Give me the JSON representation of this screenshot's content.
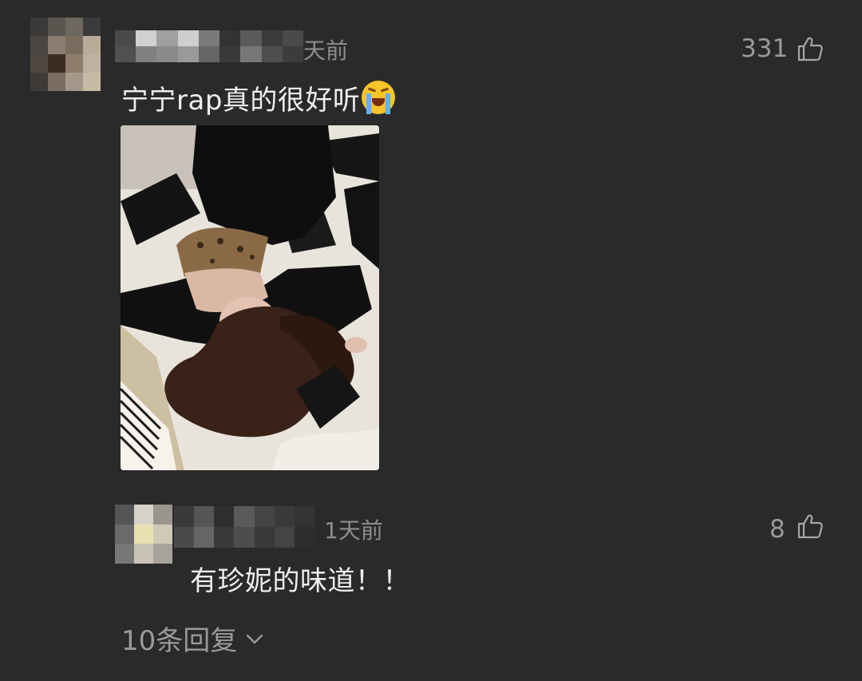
{
  "comments": [
    {
      "time": "天前",
      "likes": "331",
      "text": "宁宁rap真的很好听",
      "emoji": "crying-face",
      "has_image": true
    },
    {
      "time": "1天前",
      "likes": "8",
      "text": "有珍妮的味道！！"
    }
  ],
  "replies_label": "10条回复",
  "colors": {
    "background": "#2a2a2a",
    "text": "#eeeeee",
    "muted": "#8d8d8d"
  }
}
